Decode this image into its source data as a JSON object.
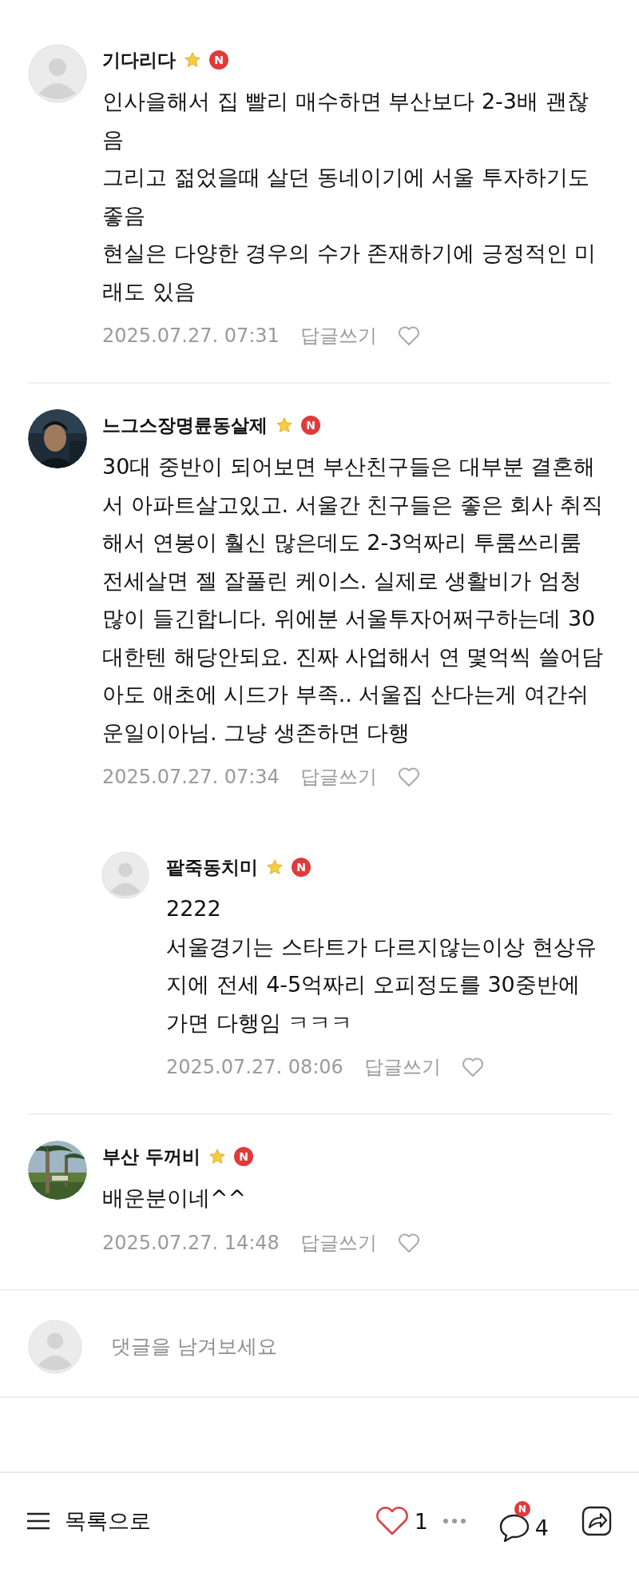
{
  "comments": [
    {
      "author": "기다리다",
      "avatar": {
        "kind": "default"
      },
      "star": true,
      "new_badge": "N",
      "text": "인사을해서 집 빨리 매수하면 부산보다 2-3배 괜찮음\n그리고 젊었을때 살던 동네이기에 서울 투자하기도 좋음\n현실은 다양한 경우의 수가 존재하기에 긍정적인 미래도 있음",
      "date": "2025.07.27. 07:31",
      "reply_label": "답글쓰기",
      "liked": false
    },
    {
      "author": "느그스장명륜동살제",
      "star": true,
      "new_badge": "N",
      "text": "30대 중반이 되어보면 부산친구들은 대부분 결혼해서 아파트살고있고. 서울간 친구들은 좋은 회사 취직해서 연봉이 훨신 많은데도 2-3억짜리 투룸쓰리룸 전세살면 젤 잘풀린 케이스. 실제로 생활비가 엄청 많이 들긴합니다. 위에분 서울투자어쩌구하는데 30대한텐 해당안되요. 진짜 사업해서 연 몇억씩 쓸어담아도 애초에 시드가 부족.. 서울집 산다는게 여간쉬운일이아님. 그냥 생존하면 다행",
      "date": "2025.07.27. 07:34",
      "reply_label": "답글쓰기",
      "liked": false,
      "replies": [
        {
          "author": "팥죽동치미",
          "avatar": {
            "kind": "default"
          },
          "star": true,
          "new_badge": "N",
          "text": "2222\n서울경기는 스타트가 다르지않는이상 현상유지에 전세 4-5억짜리 오피정도를 30중반에 가면 다행임 ㅋㅋㅋ",
          "date": "2025.07.27. 08:06",
          "reply_label": "답글쓰기",
          "liked": false
        }
      ]
    },
    {
      "author": "부산 두꺼비",
      "star": true,
      "new_badge": "N",
      "text": "배운분이네^^",
      "date": "2025.07.27. 14:48",
      "reply_label": "답글쓰기",
      "liked": false
    }
  ],
  "comment_input": {
    "placeholder": "댓글을 남겨보세요"
  },
  "bottom_bar": {
    "list_label": "목록으로",
    "likes": "1",
    "liked": true,
    "comment_badge": "N",
    "comments": "4"
  }
}
